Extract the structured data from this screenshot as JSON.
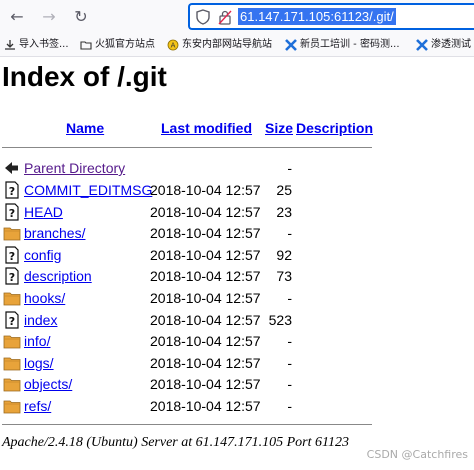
{
  "browser": {
    "url": "61.147.171.105:61123/.git/",
    "bookmarks": [
      {
        "label": "导入书签...",
        "icon": "import-icon"
      },
      {
        "label": "火狐官方站点",
        "icon": "folder-icon"
      },
      {
        "label": "东安内部网站导航站",
        "icon": "site-icon"
      },
      {
        "label": "新员工培训 - 密码测...",
        "icon": "x-logo-icon"
      },
      {
        "label": "渗透测试",
        "icon": "x-logo-icon"
      }
    ]
  },
  "page": {
    "title": "Index of /.git",
    "columns": {
      "name": "Name",
      "last_modified": "Last modified",
      "size": "Size",
      "description": "Description"
    },
    "parent": {
      "label": "Parent Directory",
      "size": "-"
    },
    "rows": [
      {
        "name": "COMMIT_EDITMSG",
        "date": "2018-10-04 12:57",
        "size": "25",
        "type": "file"
      },
      {
        "name": "HEAD",
        "date": "2018-10-04 12:57",
        "size": "23",
        "type": "file"
      },
      {
        "name": "branches/",
        "date": "2018-10-04 12:57",
        "size": "-",
        "type": "folder"
      },
      {
        "name": "config",
        "date": "2018-10-04 12:57",
        "size": "92",
        "type": "file"
      },
      {
        "name": "description",
        "date": "2018-10-04 12:57",
        "size": "73",
        "type": "file"
      },
      {
        "name": "hooks/",
        "date": "2018-10-04 12:57",
        "size": "-",
        "type": "folder"
      },
      {
        "name": "index",
        "date": "2018-10-04 12:57",
        "size": "523",
        "type": "file"
      },
      {
        "name": "info/",
        "date": "2018-10-04 12:57",
        "size": "-",
        "type": "folder"
      },
      {
        "name": "logs/",
        "date": "2018-10-04 12:57",
        "size": "-",
        "type": "folder"
      },
      {
        "name": "objects/",
        "date": "2018-10-04 12:57",
        "size": "-",
        "type": "folder"
      },
      {
        "name": "refs/",
        "date": "2018-10-04 12:57",
        "size": "-",
        "type": "folder"
      }
    ],
    "footer": "Apache/2.4.18 (Ubuntu) Server at 61.147.171.105 Port 61123"
  },
  "watermark": "CSDN @Catchfires",
  "colors": {
    "link": "#0000ee",
    "visited": "#551a8b",
    "folder": "#e8a33a",
    "url_selection": "#3574f0"
  }
}
